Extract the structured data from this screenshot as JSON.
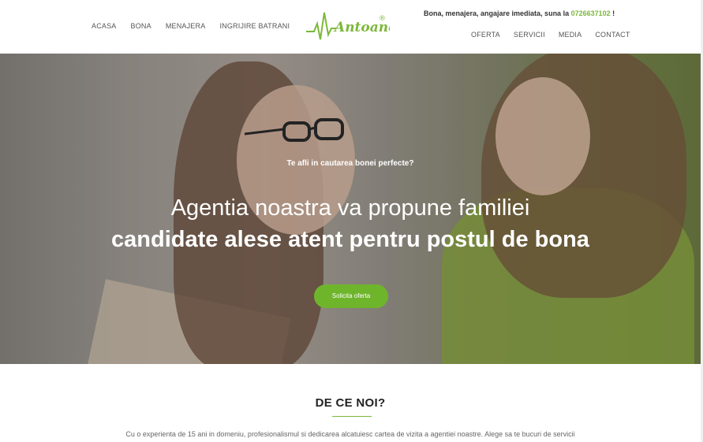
{
  "header": {
    "nav_left": [
      "ACASA",
      "BONA",
      "MENAJERA",
      "INGRIJIRE BATRANI"
    ],
    "logo_text": "Antoanette",
    "logo_mark": "®",
    "top_line_text": "Bona, menajera, angajare imediata, suna la",
    "phone": "0726637102",
    "top_line_suffix": "!",
    "nav_right": [
      "OFERTA",
      "SERVICII",
      "MEDIA",
      "CONTACT"
    ]
  },
  "hero": {
    "eyebrow": "Te afli in cautarea bonei perfecte?",
    "line1": "Agentia noastra va propune familiei",
    "line2": "candidate alese atent pentru postul de bona",
    "cta_label": "Solicita oferta"
  },
  "why": {
    "title": "DE CE NOI?",
    "text": "Cu o experienta de 15 ani in domeniu, profesionalismul si dedicarea alcatuiesc cartea de vizita a agentiei noastre. Alege sa te bucuri de servicii"
  },
  "colors": {
    "accent": "#7cb83a",
    "cta": "#6fb52c"
  }
}
